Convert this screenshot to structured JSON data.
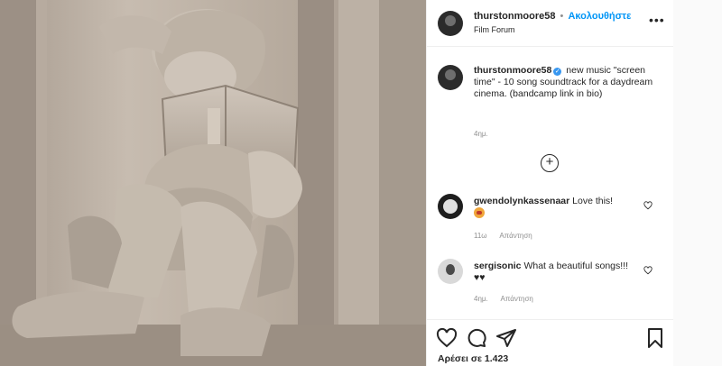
{
  "post": {
    "username": "thurstonmoore58",
    "follow_label": "Ακολουθήστε",
    "location": "Film Forum",
    "caption": "new music \"screen time\" - 10 song soundtrack for a daydream cinema. (bandcamp link in bio)",
    "time": "4ημ."
  },
  "comments": [
    {
      "username": "gwendolynkassenaar",
      "text": "Love this!",
      "time": "11ω",
      "reply_label": "Απάντηση"
    },
    {
      "username": "sergisonic",
      "text": "What a beautiful songs!!! ♥♥",
      "time": "4ημ.",
      "reply_label": "Απάντηση"
    }
  ],
  "likes_label": "Αρέσει σε 1.423",
  "icons": {
    "more": "more-options-icon",
    "load_more": "plus-circle-icon",
    "like": "heart-icon",
    "comment": "comment-icon",
    "share": "paper-plane-icon",
    "save": "bookmark-icon",
    "verified": "verified-badge-icon"
  },
  "colors": {
    "follow": "#0095f6",
    "verified": "#3897f0",
    "secondary_text": "#8e8e8e"
  }
}
